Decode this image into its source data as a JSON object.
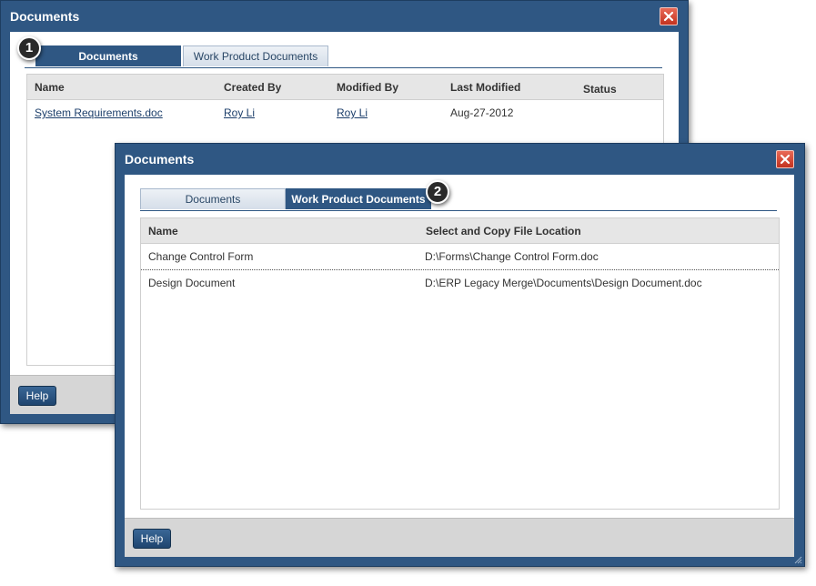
{
  "dialog1": {
    "title": "Documents",
    "badge": "1",
    "tabs": [
      {
        "label": "Documents",
        "active": true
      },
      {
        "label": "Work Product Documents",
        "active": false
      }
    ],
    "columns": [
      "Name",
      "Created By",
      "Modified By",
      "Last Modified",
      "Status"
    ],
    "rows": [
      {
        "name": "System Requirements.doc",
        "created_by": "Roy Li",
        "modified_by": "Roy Li",
        "last_modified": "Aug-27-2012",
        "status": ""
      }
    ],
    "help_label": "Help"
  },
  "dialog2": {
    "title": "Documents",
    "badge": "2",
    "tabs": [
      {
        "label": "Documents",
        "active": false
      },
      {
        "label": "Work Product Documents",
        "active": true
      }
    ],
    "columns": [
      "Name",
      "Select and Copy File Location"
    ],
    "rows": [
      {
        "name": "Change Control Form",
        "location": "D:\\Forms\\Change Control Form.doc"
      },
      {
        "name": "Design Document",
        "location": "D:\\ERP Legacy Merge\\Documents\\Design Document.doc"
      }
    ],
    "help_label": "Help"
  },
  "colors": {
    "dialog_frame": "#2f5783",
    "close_button": "#d2402c",
    "header_row": "#e6e6e6",
    "footer": "#d6d6d6"
  }
}
